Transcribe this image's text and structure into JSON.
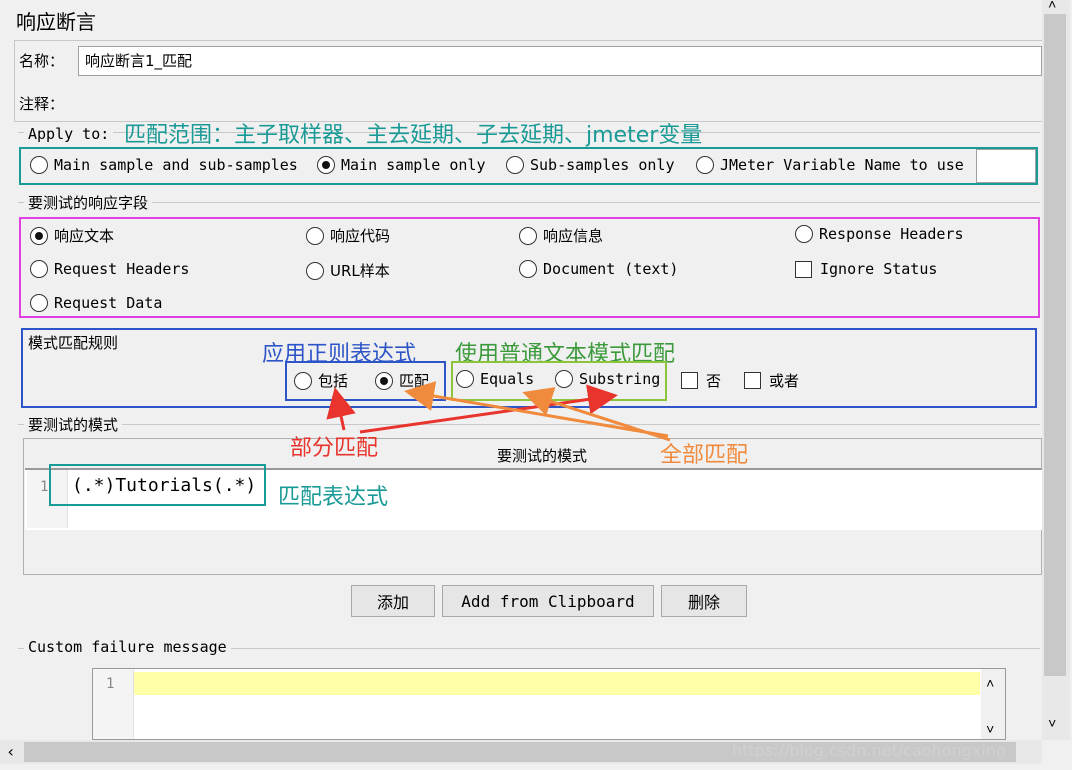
{
  "panel": {
    "title": "响应断言"
  },
  "name_row": {
    "label": "名称：",
    "value": "响应断言1_匹配"
  },
  "comment_row": {
    "label": "注释：",
    "value": ""
  },
  "apply_to": {
    "title": "Apply to:",
    "options": [
      {
        "label": "Main sample and sub-samples",
        "selected": false
      },
      {
        "label": "Main sample only",
        "selected": true
      },
      {
        "label": "Sub-samples only",
        "selected": false
      },
      {
        "label": "JMeter Variable Name to use",
        "selected": false
      }
    ],
    "variable_value": ""
  },
  "response_field": {
    "title": "要测试的响应字段",
    "options": [
      {
        "label": "响应文本",
        "selected": true
      },
      {
        "label": "响应代码",
        "selected": false
      },
      {
        "label": "响应信息",
        "selected": false
      },
      {
        "label": "Response Headers",
        "selected": false
      },
      {
        "label": "Request Headers",
        "selected": false
      },
      {
        "label": "URL样本",
        "selected": false
      },
      {
        "label": "Document (text)",
        "selected": false
      },
      {
        "label": "Request Data",
        "selected": false
      }
    ],
    "ignore_status": {
      "label": "Ignore Status",
      "checked": false
    }
  },
  "pattern_rules": {
    "title": "模式匹配规则",
    "options": [
      {
        "label": "包括",
        "selected": false
      },
      {
        "label": "匹配",
        "selected": true
      },
      {
        "label": "Equals",
        "selected": false
      },
      {
        "label": "Substring",
        "selected": false
      }
    ],
    "checks": [
      {
        "label": "否",
        "checked": false
      },
      {
        "label": "或者",
        "checked": false
      }
    ]
  },
  "patterns": {
    "title": "要测试的模式",
    "column_header": "要测试的模式",
    "rows": [
      {
        "line": "1",
        "text": "(.*)Tutorials(.*)"
      }
    ]
  },
  "buttons": {
    "add": "添加",
    "add_clipboard": "Add from Clipboard",
    "delete": "删除"
  },
  "custom_failure": {
    "title": "Custom failure message",
    "line": "1",
    "text": ""
  },
  "annotations": {
    "apply_to": "匹配范围：主子取样器、主去延期、子去延期、jmeter变量",
    "regex": "应用正则表达式",
    "plain_text": "使用普通文本模式匹配",
    "partial": "部分匹配",
    "full": "全部匹配",
    "expression": "匹配表达式"
  },
  "watermark": "https://blog.csdn.net/caohongxing",
  "colors": {
    "teal": "#1a9a96",
    "magenta": "#e040e0",
    "blue": "#2d55c8",
    "green": "#8cc43c",
    "red": "#e8342c",
    "orange": "#f08a3c",
    "editor_highlight": "#ffffa8"
  }
}
